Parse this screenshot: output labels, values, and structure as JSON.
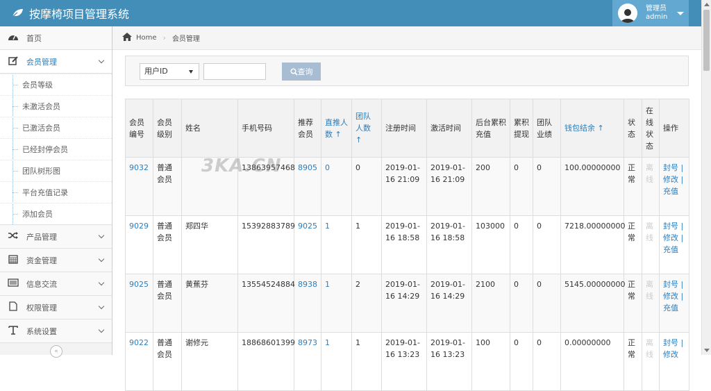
{
  "app": {
    "title": "按摩椅项目管理系统"
  },
  "user": {
    "role": "管理员",
    "name": "admin"
  },
  "sidebar": {
    "items": [
      {
        "label": "首页",
        "icon": "dashboard-icon"
      },
      {
        "label": "会员管理",
        "icon": "edit-icon"
      },
      {
        "label": "产品管理",
        "icon": "shuffle-icon"
      },
      {
        "label": "资金管理",
        "icon": "calendar-icon"
      },
      {
        "label": "信息交流",
        "icon": "list-icon"
      },
      {
        "label": "权限管理",
        "icon": "file-icon"
      },
      {
        "label": "系统设置",
        "icon": "text-icon"
      }
    ],
    "sub_items": [
      "会员等级",
      "未激活会员",
      "已激活会员",
      "已经封停会员",
      "团队树形图",
      "平台充值记录",
      "添加会员"
    ],
    "collapse": "«"
  },
  "breadcrumb": {
    "home": "Home",
    "current": "会员管理"
  },
  "search": {
    "select_value": "用户ID",
    "button": "查询"
  },
  "watermark": "3KA.CN",
  "table": {
    "headers": [
      "会员编号",
      "会员级别",
      "姓名",
      "手机号码",
      "推荐会员",
      "直推人数 ↑",
      "团队人数 ↑",
      "注册时间",
      "激活时间",
      "后台累积充值",
      "累积提现",
      "团队业绩",
      "钱包结余 ↑",
      "状态",
      "在线状态",
      "操作"
    ],
    "rows": [
      {
        "id": "9032",
        "level": "普通会员",
        "name": "",
        "phone": "13863957468",
        "referrer": "8905",
        "direct": "0",
        "team": "0",
        "reg": "2019-01-16 21:09",
        "act": "2019-01-16 21:09",
        "recharge": "200",
        "withdraw": "0",
        "perf": "0",
        "wallet": "100.00000000",
        "status": "正常",
        "online": "离线",
        "ops": "封号 | 修改 | 充值"
      },
      {
        "id": "9029",
        "level": "普通会员",
        "name": "郑四华",
        "phone": "15392883789",
        "referrer": "9025",
        "direct": "1",
        "team": "1",
        "reg": "2019-01-16 18:58",
        "act": "2019-01-16 18:58",
        "recharge": "103000",
        "withdraw": "0",
        "perf": "0",
        "wallet": "7218.00000000",
        "status": "正常",
        "online": "离线",
        "ops": "封号 | 修改 | 充值"
      },
      {
        "id": "9025",
        "level": "普通会员",
        "name": "黄蕉芬",
        "phone": "13554524884",
        "referrer": "8938",
        "direct": "1",
        "team": "2",
        "reg": "2019-01-16 14:29",
        "act": "2019-01-16 14:29",
        "recharge": "2100",
        "withdraw": "0",
        "perf": "0",
        "wallet": "5145.00000000",
        "status": "正常",
        "online": "离线",
        "ops": "封号 | 修改 | 充值"
      },
      {
        "id": "9022",
        "level": "普通会员",
        "name": "谢修元",
        "phone": "18868601399",
        "referrer": "8973",
        "direct": "1",
        "team": "1",
        "reg": "2019-01-16 13:23",
        "act": "2019-01-16 13:23",
        "recharge": "100",
        "withdraw": "0",
        "perf": "0",
        "wallet": "0.00000000",
        "status": "正常",
        "online": "离线",
        "ops": "封号 | 修改"
      }
    ]
  }
}
